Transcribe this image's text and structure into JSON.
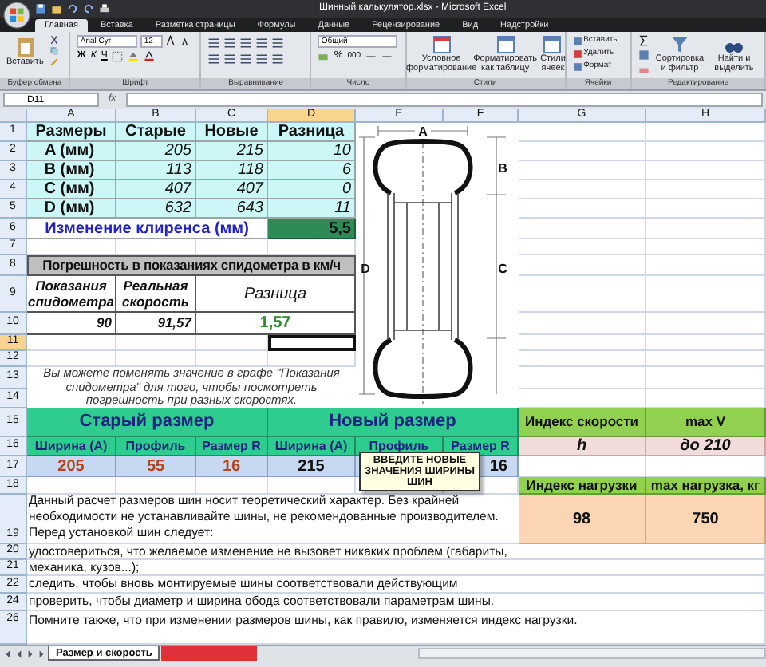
{
  "window": {
    "title": "Шинный калькулятор.xlsx - Microsoft Excel"
  },
  "ribbon": {
    "tabs": [
      {
        "label": "Главная",
        "selected": true
      },
      {
        "label": "Вставка",
        "selected": false
      },
      {
        "label": "Разметка страницы",
        "selected": false
      },
      {
        "label": "Формулы",
        "selected": false
      },
      {
        "label": "Данные",
        "selected": false
      },
      {
        "label": "Рецензирование",
        "selected": false
      },
      {
        "label": "Вид",
        "selected": false
      },
      {
        "label": "Надстройки",
        "selected": false
      }
    ],
    "clipboard": {
      "label": "Буфер обмена",
      "paste": "Вставить"
    },
    "font": {
      "label": "Шрифт",
      "name": "Arial Cyr",
      "size": "12",
      "bold": "Ж",
      "italic": "К",
      "underline": "Ч"
    },
    "alignment": {
      "label": "Выравнивание"
    },
    "number": {
      "label": "Число",
      "format": "Общий",
      "percent": "%",
      "thousands": "000"
    },
    "styles": {
      "label": "Стили",
      "buttons": [
        "Условное форматирование",
        "Форматировать как таблицу",
        "Стили ячеек"
      ]
    },
    "cells": {
      "label": "Ячейки",
      "buttons": [
        "Вставить",
        "Удалить",
        "Формат"
      ]
    },
    "editing": {
      "label": "Редактирование",
      "buttons": [
        "Сортировка и фильтр",
        "Найти и выделить"
      ]
    }
  },
  "formula_bar": {
    "name_box": "D11",
    "function_button": "fx"
  },
  "columns": [
    {
      "label": "A",
      "selected": false
    },
    {
      "label": "B",
      "selected": false
    },
    {
      "label": "C",
      "selected": false
    },
    {
      "label": "D",
      "selected": true
    },
    {
      "label": "E",
      "selected": false
    },
    {
      "label": "F",
      "selected": false
    },
    {
      "label": "G",
      "selected": false
    },
    {
      "label": "H",
      "selected": false
    }
  ],
  "rows": [
    {
      "label": "1",
      "selected": false
    },
    {
      "label": "2",
      "selected": false
    },
    {
      "label": "3",
      "selected": false
    },
    {
      "label": "4",
      "selected": false
    },
    {
      "label": "5",
      "selected": false
    },
    {
      "label": "6",
      "selected": false
    },
    {
      "label": "7",
      "selected": false
    },
    {
      "label": "8",
      "selected": false
    },
    {
      "label": "9",
      "selected": false
    },
    {
      "label": "10",
      "selected": false
    },
    {
      "label": "11",
      "selected": true
    },
    {
      "label": "12",
      "selected": false
    },
    {
      "label": "13",
      "selected": false
    },
    {
      "label": "14",
      "selected": false
    },
    {
      "label": "15",
      "selected": false
    },
    {
      "label": "16",
      "selected": false
    },
    {
      "label": "17",
      "selected": false
    },
    {
      "label": "18",
      "selected": false
    },
    {
      "label": "19",
      "selected": false
    },
    {
      "label": "20",
      "selected": false
    },
    {
      "label": "21",
      "selected": false
    },
    {
      "label": "22",
      "selected": false
    },
    {
      "label": "24",
      "selected": false
    },
    {
      "label": "26",
      "selected": false
    }
  ],
  "size_table": {
    "columns": [
      "Размеры",
      "Старые",
      "Новые",
      "Разница"
    ],
    "rows": [
      [
        "A (мм)",
        "205",
        "215",
        "10"
      ],
      [
        "B (мм)",
        "113",
        "118",
        "6"
      ],
      [
        "C (мм)",
        "407",
        "407",
        "0"
      ],
      [
        "D (мм)",
        "632",
        "643",
        "11"
      ]
    ],
    "clearance": {
      "label": "Изменение клиренса (мм)",
      "value": "5,5"
    }
  },
  "speedometer": {
    "title": "Погрешность в показаниях спидометра в км/ч",
    "columns": [
      "Показания спидометра",
      "Реальная скорость",
      "Разница"
    ],
    "values": [
      "90",
      "91,57",
      "1,57"
    ]
  },
  "speedometer_note": "Вы можете поменять значение в графе \"Показания спидометра\" для того, чтобы посмотреть погрешность при разных скоростях.",
  "diagram_labels": [
    "A",
    "B",
    "C",
    "D"
  ],
  "old_size": {
    "title": "Старый размер",
    "columns": [
      "Ширина (А)",
      "Профиль",
      "Размер R"
    ],
    "values": [
      "205",
      "55",
      "16"
    ]
  },
  "new_size": {
    "title": "Новый размер",
    "width": {
      "header": "Ширина (А)",
      "value": "215"
    },
    "profile": {
      "header": "Профиль"
    },
    "rim": {
      "header": "Размер R",
      "value": "16"
    }
  },
  "comment": "ВВЕДИТЕ НОВЫЕ ЗНАЧЕНИЯ ШИРИНЫ ШИН",
  "speed": {
    "index_header": "Индекс скорости",
    "index": "h",
    "max_header": "max V",
    "max": "до 210"
  },
  "load": {
    "index_header": "Индекс нагрузки",
    "index": "98",
    "max_header": "max нагрузка, кг",
    "max": "750"
  },
  "notes": [
    "Данный расчет размеров шин носит теоретический характер. Без крайней необходимости не устанавливайте шины, не рекомендованные производителем.",
    "Перед установкой шин следует:",
    "удостовериться, что желаемое изменение не вызовет никаких проблем (габариты,",
    "механика, кузов...);",
    "следить, чтобы вновь монтируемые шины соответствовали действующим",
    "проверить, чтобы диаметр и ширина обода соответствовали параметрам шины.",
    "Помните также, что при изменении размеров шины, как правило, изменяется индекс нагрузки."
  ],
  "sheet_tabs": [
    {
      "label": "Размер и скорость",
      "selected": true
    },
    {
      "selected": false
    }
  ]
}
